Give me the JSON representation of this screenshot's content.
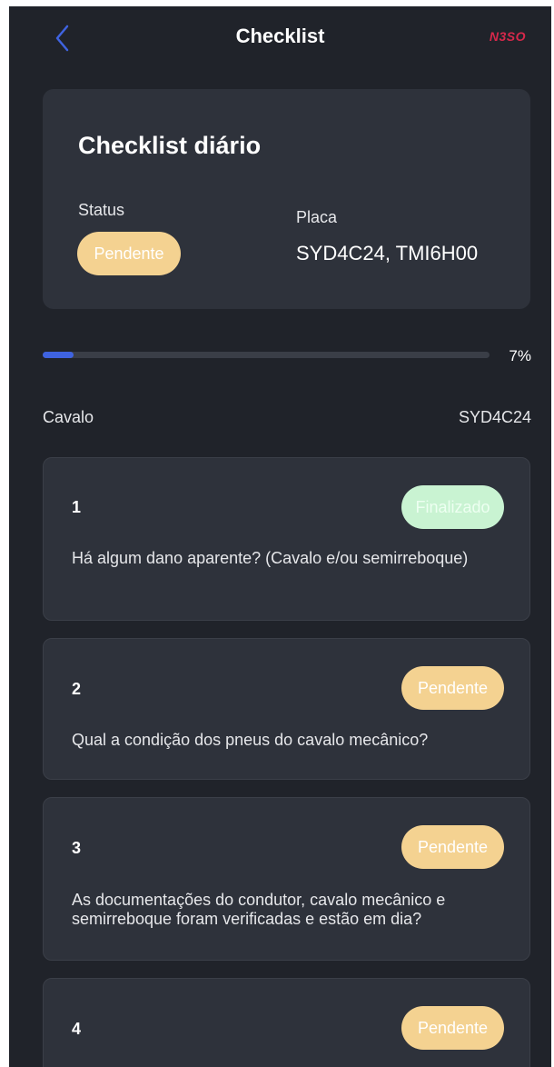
{
  "header": {
    "title": "Checklist",
    "logo_text": "N3SO",
    "back_icon": "chevron-left-icon",
    "accent_color": "#3f63e0"
  },
  "summary": {
    "title": "Checklist diário",
    "status_label": "Status",
    "status_value": "Pendente",
    "plate_label": "Placa",
    "plate_value": "SYD4C24, TMI6H00"
  },
  "progress": {
    "percent_text": "7%",
    "value": 0.07
  },
  "section": {
    "left_label": "Cavalo",
    "right_label": "SYD4C24"
  },
  "items": [
    {
      "number": "1",
      "status": "Finalizado",
      "question": "Há algum dano aparente? (Cavalo e/ou semirreboque)"
    },
    {
      "number": "2",
      "status": "Pendente",
      "question": "Qual a condição dos pneus do cavalo mecânico?"
    },
    {
      "number": "3",
      "status": "Pendente",
      "question": "As documentações do condutor, cavalo mecânico e semirreboque foram verificadas e estão em dia?"
    },
    {
      "number": "4",
      "status": "Pendente",
      "question": ""
    }
  ],
  "colors": {
    "background": "#20232a",
    "card": "#2e323b",
    "pending": "#f4d291",
    "done": "#c9f3d2"
  }
}
